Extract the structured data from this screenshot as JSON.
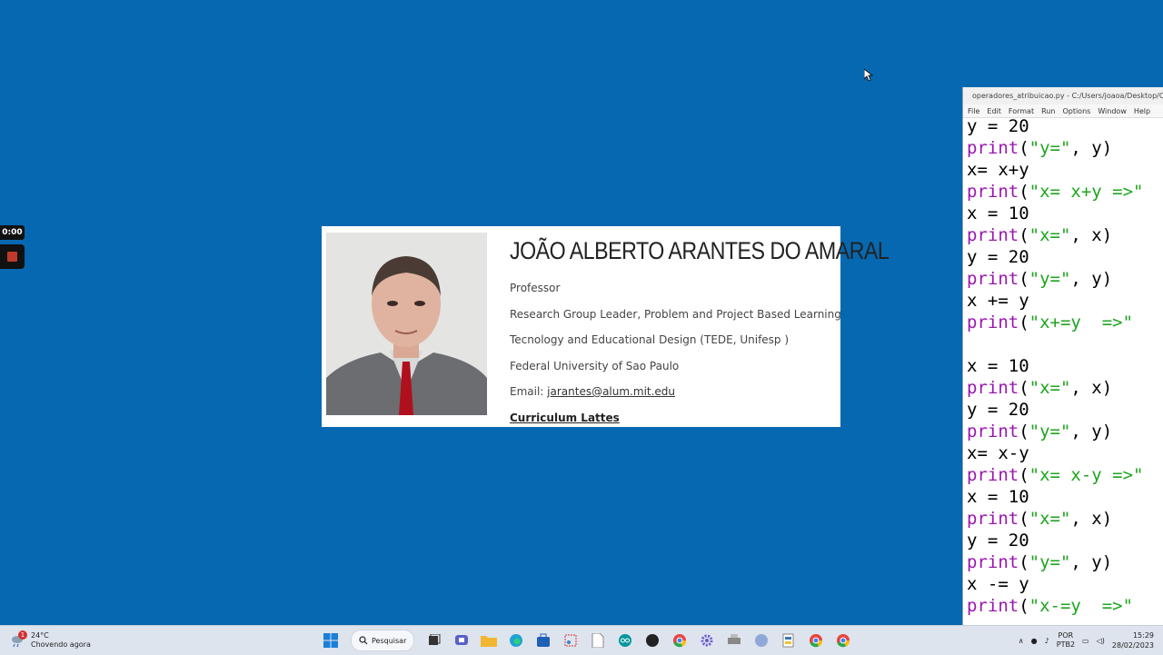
{
  "recorder": {
    "time": "0:00"
  },
  "profile": {
    "name": "JOÃO ALBERTO ARANTES DO AMARAL",
    "lines": [
      "Professor",
      "Research Group Leader, Problem and Project Based Learning",
      "Tecnology and Educational Design (TEDE, Unifesp )",
      "Federal University of Sao Paulo"
    ],
    "email_label": "Email: ",
    "email": "jarantes@alum.mit.edu",
    "lattes": "Curriculum Lattes"
  },
  "idle": {
    "title": "operadores_atribuicao.py - C:/Users/joaoa/Desktop/Curso",
    "menu": [
      "File",
      "Edit",
      "Format",
      "Run",
      "Options",
      "Window",
      "Help"
    ]
  },
  "taskbar": {
    "weather": {
      "temp": "24°C",
      "desc": "Chovendo agora",
      "badge": "1"
    },
    "search_label": "Pesquisar",
    "lang": [
      "POR",
      "PTB2"
    ],
    "time": "15:29",
    "date": "28/02/2023"
  },
  "colors": {
    "desktop": "#0668b0",
    "keyword": "#9a16b0",
    "string": "#1ea41e"
  }
}
